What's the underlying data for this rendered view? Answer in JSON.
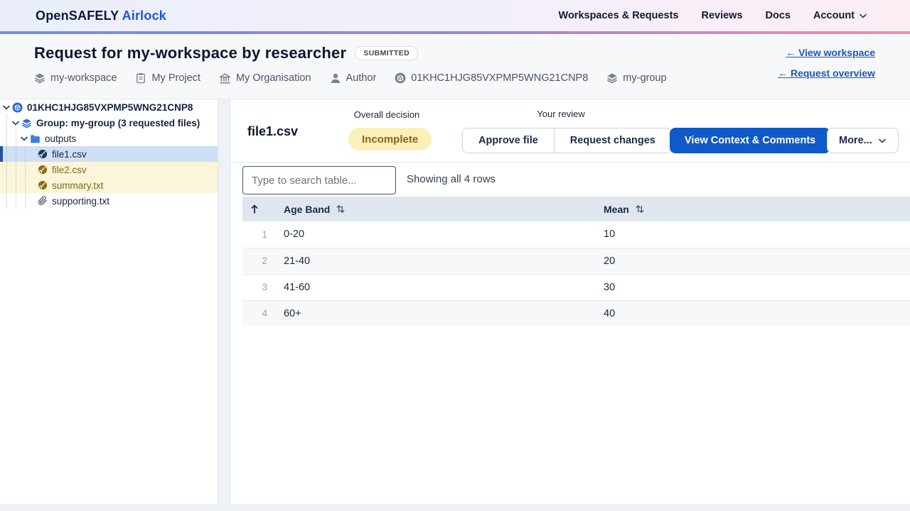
{
  "colors": {
    "accent_blue": "#1059c9",
    "link_blue": "#1b56c4",
    "selected_row_bg": "#cfdff5",
    "selected_row_border": "#1f51a3",
    "pending_row_bg": "#fbf5da",
    "pending_text": "#7d661f",
    "decision_badge_bg": "#fcf0ba",
    "decision_badge_text": "#8a6116"
  },
  "nav": {
    "brand_primary": "OpenSAFELY",
    "brand_secondary": "Airlock",
    "items": [
      {
        "label": "Workspaces & Requests"
      },
      {
        "label": "Reviews"
      },
      {
        "label": "Docs"
      },
      {
        "label": "Account",
        "has_dropdown": true
      }
    ]
  },
  "header": {
    "title": "Request for my-workspace by researcher",
    "status": "SUBMITTED",
    "link_workspace": "← View workspace",
    "link_overview": "← Request overview",
    "meta": [
      {
        "icon": "layers-icon",
        "label": "my-workspace"
      },
      {
        "icon": "clipboard-icon",
        "label": "My Project"
      },
      {
        "icon": "organisation-icon",
        "label": "My Organisation"
      },
      {
        "icon": "user-icon",
        "label": "Author"
      },
      {
        "icon": "request-icon",
        "label": "01KHC1HJG85VXPMP5WNG21CNP8"
      },
      {
        "icon": "layers-icon",
        "label": "my-group"
      }
    ]
  },
  "sidebar": {
    "tree": [
      {
        "label": "01KHC1HJG85VXPMP5WNG21CNP8",
        "level": 0,
        "icon": "request-icon",
        "expanded": true
      },
      {
        "label": "Group: my-group (3 requested files)",
        "level": 1,
        "icon": "group-layers-icon",
        "expanded": true
      },
      {
        "label": "outputs",
        "level": 2,
        "icon": "folder-icon",
        "expanded": true
      },
      {
        "label": "file1.csv",
        "level": 3,
        "icon": "file-status-icon",
        "state": "selected"
      },
      {
        "label": "file2.csv",
        "level": 3,
        "icon": "file-status-icon",
        "state": "pending"
      },
      {
        "label": "summary.txt",
        "level": 3,
        "icon": "file-status-icon",
        "state": "pending"
      },
      {
        "label": "supporting.txt",
        "level": 3,
        "icon": "paperclip-icon",
        "state": "none"
      }
    ]
  },
  "main": {
    "file_title": "file1.csv",
    "overall_decision_label": "Overall decision",
    "overall_decision_value": "Incomplete",
    "your_review_label": "Your review",
    "approve_button": "Approve file",
    "request_changes_button": "Request changes",
    "context_button": "View Context & Comments",
    "more_button": "More...",
    "search_placeholder": "Type to search table...",
    "rows_summary": "Showing all 4 rows",
    "table": {
      "columns": [
        "Age Band",
        "Mean"
      ],
      "rows": [
        {
          "n": "1",
          "age_band": "0-20",
          "mean": "10"
        },
        {
          "n": "2",
          "age_band": "21-40",
          "mean": "20"
        },
        {
          "n": "3",
          "age_band": "41-60",
          "mean": "30"
        },
        {
          "n": "4",
          "age_band": "60+",
          "mean": "40"
        }
      ]
    }
  }
}
